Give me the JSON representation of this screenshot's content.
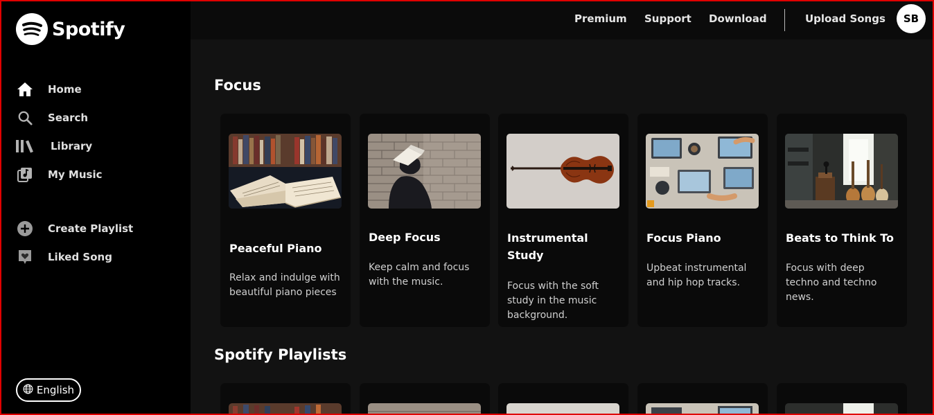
{
  "brand": {
    "name": "Spotify"
  },
  "sidebar": {
    "nav": [
      {
        "label": "Home",
        "icon": "home-icon"
      },
      {
        "label": "Search",
        "icon": "search-icon"
      },
      {
        "label": "Library",
        "icon": "library-icon"
      },
      {
        "label": "My Music",
        "icon": "music-note-icon"
      }
    ],
    "actions": [
      {
        "label": "Create Playlist",
        "icon": "plus-circle-icon"
      },
      {
        "label": "Liked Song",
        "icon": "heart-icon"
      }
    ],
    "language": "English"
  },
  "topbar": {
    "links": [
      "Premium",
      "Support",
      "Download"
    ],
    "upload": "Upload Songs",
    "avatar": "SB"
  },
  "sections": [
    {
      "title": "Focus",
      "cards": [
        {
          "title": "Peaceful Piano",
          "desc": "Relax and indulge with beautiful piano pieces"
        },
        {
          "title": "Deep Focus",
          "desc": "Keep calm and focus with the music."
        },
        {
          "title": "Instrumental Study",
          "desc": "Focus with the soft study in the music background."
        },
        {
          "title": "Focus Piano",
          "desc": "Upbeat instrumental and hip hop tracks."
        },
        {
          "title": "Beats to Think To",
          "desc": "Focus with deep techno and techno news."
        }
      ]
    },
    {
      "title": "Spotify Playlists"
    }
  ],
  "colors": {
    "background": "#000000",
    "main": "#121212",
    "card": "#0a0a0a",
    "frame": "#e00000"
  }
}
